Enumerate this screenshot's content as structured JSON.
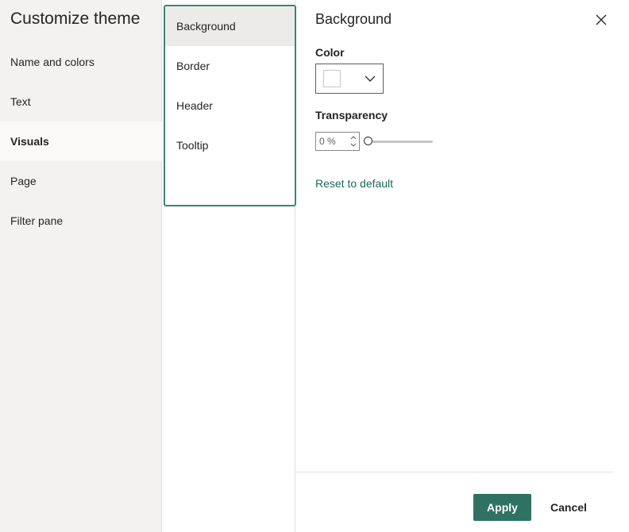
{
  "dialog": {
    "title": "Customize theme"
  },
  "nav": {
    "items": [
      {
        "label": "Name and colors",
        "selected": false
      },
      {
        "label": "Text",
        "selected": false
      },
      {
        "label": "Visuals",
        "selected": true
      },
      {
        "label": "Page",
        "selected": false
      },
      {
        "label": "Filter pane",
        "selected": false
      }
    ]
  },
  "subnav": {
    "items": [
      {
        "label": "Background",
        "selected": true
      },
      {
        "label": "Border",
        "selected": false
      },
      {
        "label": "Header",
        "selected": false
      },
      {
        "label": "Tooltip",
        "selected": false
      }
    ]
  },
  "panel": {
    "title": "Background",
    "color_label": "Color",
    "color_value": "#ffffff",
    "transparency_label": "Transparency",
    "transparency_value": "0 %",
    "transparency_percent": 0,
    "reset_label": "Reset to default"
  },
  "footer": {
    "apply_label": "Apply",
    "cancel_label": "Cancel"
  },
  "colors": {
    "accent": "#2f7263",
    "link": "#1a6b57",
    "selected_outline": "#3b8573",
    "nav_background": "#f3f2f1"
  },
  "icons": {
    "close": "close-icon",
    "dropdown": "chevron-down-icon",
    "spin_up": "chevron-up-icon",
    "spin_down": "chevron-down-icon"
  }
}
